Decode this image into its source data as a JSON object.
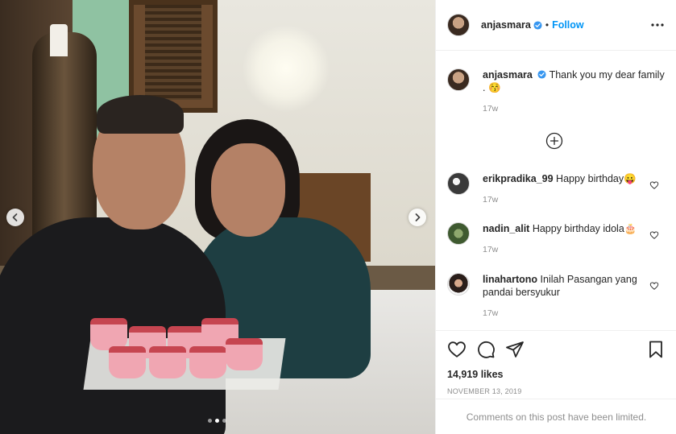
{
  "post": {
    "username": "anjasmara",
    "verified": true,
    "separator": "•",
    "follow_label": "Follow",
    "more_icon": "more-horizontal-icon"
  },
  "caption": {
    "username": "anjasmara",
    "text": "Thank you my dear family . 😚",
    "time": "17w"
  },
  "comments": [
    {
      "username": "erikpradika_99",
      "text": "Happy birthday😛",
      "time": "17w"
    },
    {
      "username": "nadin_alit",
      "text": "Happy birthday idola🎂",
      "time": "17w"
    },
    {
      "username": "linahartono",
      "text": "Inilah Pasangan yang pandai bersyukur",
      "time": "17w"
    }
  ],
  "actions": {
    "like_icon": "heart-icon",
    "comment_icon": "comment-bubble-icon",
    "share_icon": "paper-plane-icon",
    "save_icon": "bookmark-icon"
  },
  "likes": "14,919 likes",
  "date": "NOVEMBER 13, 2019",
  "comments_limited": "Comments on this post have been limited.",
  "carousel": {
    "slides": 3,
    "active_index": 1
  },
  "colors": {
    "accent": "#0095f6",
    "muted": "#8e8e8e",
    "text": "#262626",
    "border": "#efefef"
  }
}
